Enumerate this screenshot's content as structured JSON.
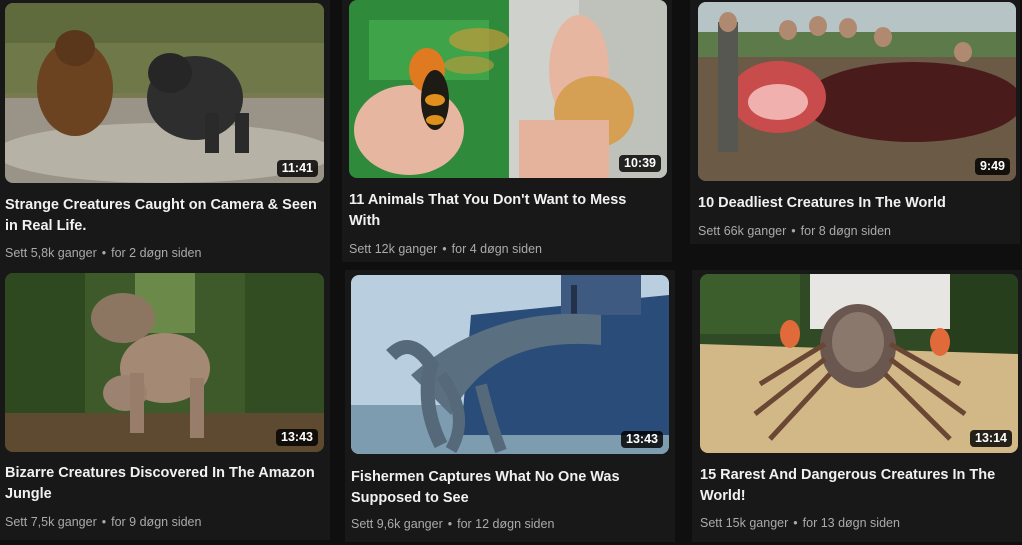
{
  "videos": [
    {
      "title": "Strange Creatures Caught on Camera & Seen in Real Life.",
      "duration": "11:41",
      "views": "Sett 5,8k ganger",
      "age": "for 2 døgn siden"
    },
    {
      "title": "11 Animals That You Don't Want to Mess With",
      "duration": "10:39",
      "views": "Sett 12k ganger",
      "age": "for 4 døgn siden"
    },
    {
      "title": "10 Deadliest Creatures In The World",
      "duration": "9:49",
      "views": "Sett 66k ganger",
      "age": "for 8 døgn siden"
    },
    {
      "title": "Bizarre Creatures Discovered In The Amazon Jungle",
      "duration": "13:43",
      "views": "Sett 7,5k ganger",
      "age": "for 9 døgn siden"
    },
    {
      "title": "Fishermen Captures What No One Was Supposed to See",
      "duration": "13:43",
      "views": "Sett 9,6k ganger",
      "age": "for 12 døgn siden"
    },
    {
      "title": "15 Rarest And Dangerous Creatures In The World!",
      "duration": "13:14",
      "views": "Sett 15k ganger",
      "age": "for 13 døgn siden"
    }
  ],
  "meta_separator": "•"
}
